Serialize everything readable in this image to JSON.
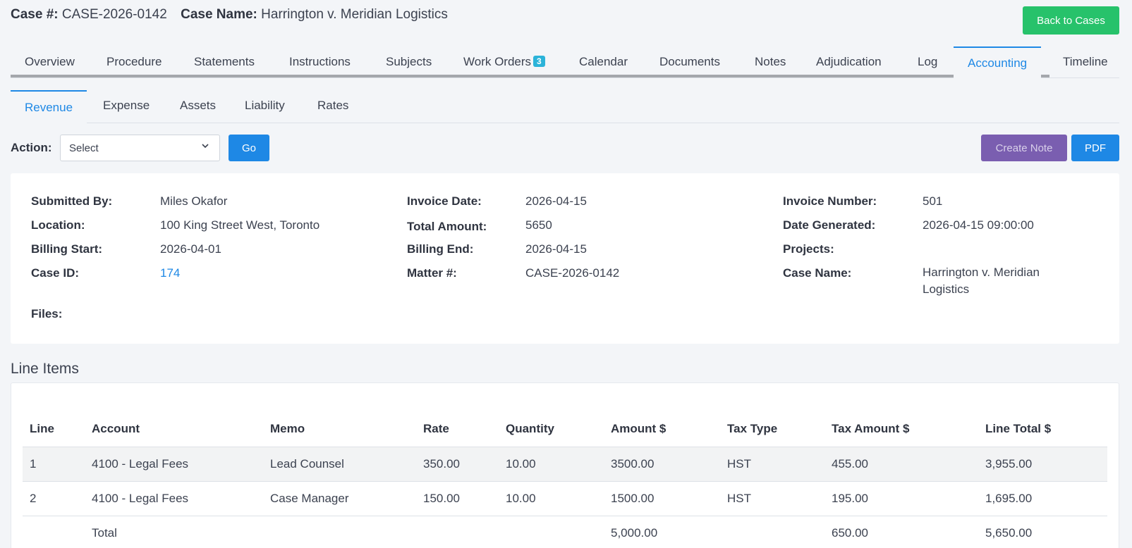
{
  "header": {
    "case_number_label": "Case #:",
    "case_number": "CASE-2026-0142",
    "case_name_label": "Case Name:",
    "case_name": "Harrington v. Meridian Logistics",
    "back_button": "Back to Cases"
  },
  "main_tabs": [
    {
      "label": "Overview"
    },
    {
      "label": "Procedure"
    },
    {
      "label": "Statements"
    },
    {
      "label": "Instructions"
    },
    {
      "label": "Subjects"
    },
    {
      "label": "Work Orders",
      "badge": "3"
    },
    {
      "label": "Calendar"
    },
    {
      "label": "Documents"
    },
    {
      "label": "Notes"
    },
    {
      "label": "Adjudication"
    },
    {
      "label": "Log"
    },
    {
      "label": "Accounting",
      "active": true
    },
    {
      "label": "Timeline"
    }
  ],
  "sub_tabs": [
    {
      "label": "Revenue",
      "active": true
    },
    {
      "label": "Expense"
    },
    {
      "label": "Assets"
    },
    {
      "label": "Liability"
    },
    {
      "label": "Rates"
    }
  ],
  "action": {
    "label": "Action:",
    "select_value": "Select",
    "go_button": "Go",
    "create_note_button": "Create Note",
    "pdf_button": "PDF"
  },
  "details": {
    "submitted_by_label": "Submitted By:",
    "submitted_by": "Miles Okafor",
    "location_label": "Location:",
    "location": "100 King Street West, Toronto",
    "billing_start_label": "Billing Start:",
    "billing_start": "2026-04-01",
    "case_id_label": "Case ID:",
    "case_id": "174",
    "files_label": "Files:",
    "invoice_date_label": "Invoice Date:",
    "invoice_date": "2026-04-15",
    "total_amount_label": "Total Amount:",
    "total_amount": "5650",
    "billing_end_label": "Billing End:",
    "billing_end": "2026-04-15",
    "matter_label": "Matter #:",
    "matter": "CASE-2026-0142",
    "invoice_number_label": "Invoice Number:",
    "invoice_number": "501",
    "date_generated_label": "Date Generated:",
    "date_generated": "2026-04-15 09:00:00",
    "projects_label": "Projects:",
    "case_name_label": "Case Name:",
    "case_name": "Harrington v. Meridian Logistics"
  },
  "line_items": {
    "title": "Line Items",
    "columns": [
      "Line",
      "Account",
      "Memo",
      "Rate",
      "Quantity",
      "Amount $",
      "Tax Type",
      "Tax Amount $",
      "Line Total $"
    ],
    "rows": [
      [
        "1",
        "4100 - Legal Fees",
        "Lead Counsel",
        "350.00",
        "10.00",
        "3500.00",
        "HST",
        "455.00",
        "3,955.00"
      ],
      [
        "2",
        "4100 - Legal Fees",
        "Case Manager",
        "150.00",
        "10.00",
        "1500.00",
        "HST",
        "195.00",
        "1,695.00"
      ]
    ],
    "total": {
      "label": "Total",
      "amount": "5,000.00",
      "tax_amount": "650.00",
      "line_total": "5,650.00"
    }
  }
}
